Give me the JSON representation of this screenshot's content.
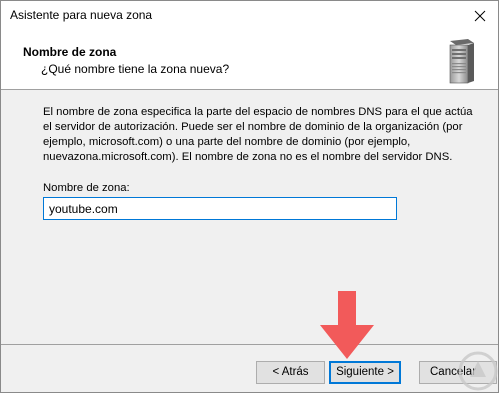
{
  "window": {
    "title": "Asistente para nueva zona",
    "close_glyph": "✕"
  },
  "header": {
    "title": "Nombre de zona",
    "subtitle": "¿Qué nombre tiene la zona  nueva?",
    "icon": "server-icon"
  },
  "content": {
    "description": "El nombre de zona especifica la parte del espacio de nombres DNS para el que actúa el servidor de autorización. Puede ser el nombre de dominio de la organización (por ejemplo, microsoft.com) o una parte del nombre de dominio (por ejemplo, nuevazona.microsoft.com). El nombre de zona no es el nombre del servidor DNS.",
    "zone_label": "Nombre de zona:",
    "zone_value": "youtube.com"
  },
  "buttons": {
    "back": "< Atrás",
    "next": "Siguiente >",
    "cancel": "Cancelar"
  },
  "colors": {
    "accent": "#0078d7",
    "arrow": "#f25a5a"
  }
}
